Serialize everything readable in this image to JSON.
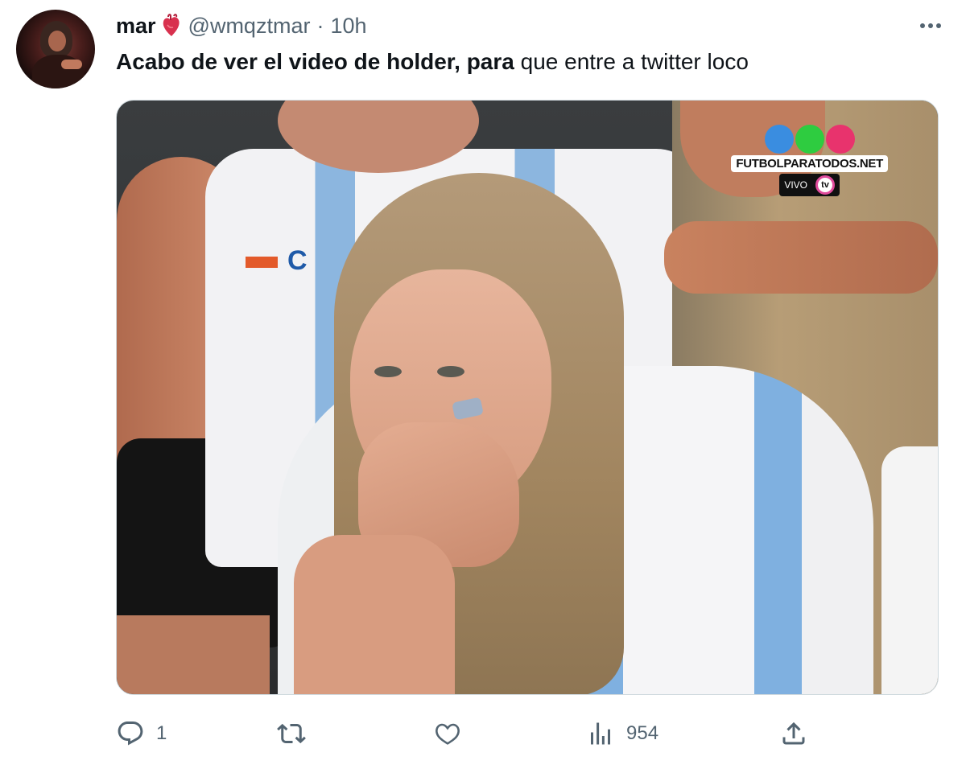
{
  "tweet": {
    "author_name": "mar",
    "author_emoji": "anatomical-heart-icon",
    "handle": "@wmqztmar",
    "separator": "·",
    "time": "10h",
    "text_bold": "Acabo de ver el video de holder, para",
    "text_rest": " que entre a twitter loco",
    "media": {
      "watermark": "FUTBOLPARATODOS.NET",
      "live_label": "VIVO",
      "channel": "tv",
      "dot_colors": [
        "#3a8de0",
        "#2ecc40",
        "#e8336d"
      ]
    },
    "stats": {
      "replies": "1",
      "views": "954"
    }
  },
  "colors": {
    "text_primary": "#0f1419",
    "text_secondary": "#536471",
    "border": "#cfd9de"
  }
}
